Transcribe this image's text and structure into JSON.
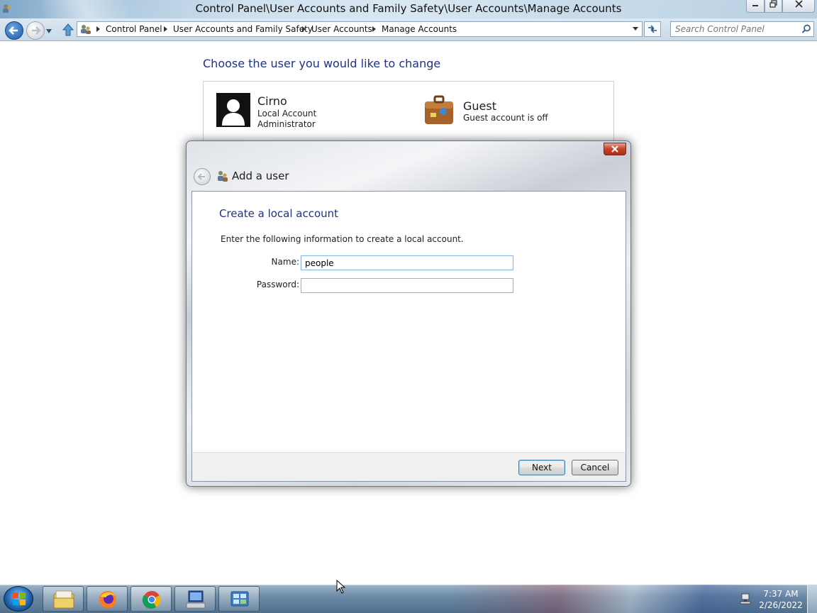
{
  "window": {
    "title": "Control Panel\\User Accounts and Family Safety\\User Accounts\\Manage Accounts",
    "breadcrumbs": [
      "Control Panel",
      "User Accounts and Family Safety",
      "User Accounts",
      "Manage Accounts"
    ],
    "search_placeholder": "Search Control Panel"
  },
  "main": {
    "heading": "Choose the user you would like to change",
    "users": [
      {
        "name": "Cirno",
        "line1": "Local Account",
        "line2": "Administrator"
      },
      {
        "name": "Guest",
        "line1": "Guest account is off"
      }
    ]
  },
  "dialog": {
    "title": "Add a user",
    "heading": "Create a local account",
    "instructions": "Enter the following information to create a local account.",
    "name_label": "Name:",
    "name_value": "people",
    "password_label": "Password:",
    "password_value": "",
    "next_label": "Next",
    "cancel_label": "Cancel"
  },
  "taskbar": {
    "time": "7:37 AM",
    "date": "2/26/2022",
    "apps": [
      "file-explorer-icon",
      "firefox-icon",
      "chrome-icon",
      "computer-management-icon",
      "control-panel-icon"
    ]
  },
  "colors": {
    "heading_blue": "#1e3287",
    "titlebar": "#cfe0ee",
    "taskbar": "#6b8aa6"
  }
}
